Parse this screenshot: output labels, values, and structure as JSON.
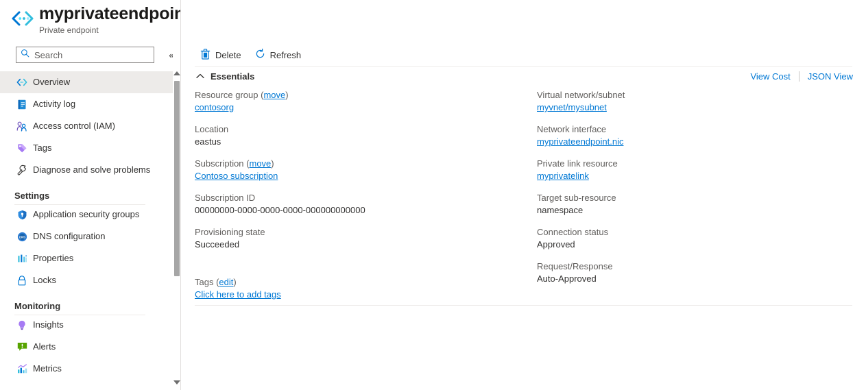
{
  "header": {
    "resource_icon": "private-endpoint-icon",
    "title": "myprivateendpoint",
    "subtitle": "Private endpoint",
    "favorite_icon": "star-icon",
    "more_icon": "ellipsis-icon",
    "more_label": "···",
    "close_icon": "close-icon"
  },
  "sidebar": {
    "search": {
      "placeholder": "Search",
      "value": "",
      "icon": "search-icon"
    },
    "collapse_icon": "chevron-double-left-icon",
    "collapse_label": "«",
    "items": [
      {
        "label": "Overview",
        "icon": "private-endpoint-icon",
        "selected": true
      },
      {
        "label": "Activity log",
        "icon": "activity-log-icon",
        "selected": false
      },
      {
        "label": "Access control (IAM)",
        "icon": "access-control-icon",
        "selected": false
      },
      {
        "label": "Tags",
        "icon": "tag-icon",
        "selected": false
      },
      {
        "label": "Diagnose and solve problems",
        "icon": "wrench-icon",
        "selected": false
      }
    ],
    "group_settings": "Settings",
    "settings_items": [
      {
        "label": "Application security groups",
        "icon": "shield-icon"
      },
      {
        "label": "DNS configuration",
        "icon": "dns-icon"
      },
      {
        "label": "Properties",
        "icon": "properties-icon"
      },
      {
        "label": "Locks",
        "icon": "lock-icon"
      }
    ],
    "group_monitoring": "Monitoring",
    "monitoring_items": [
      {
        "label": "Insights",
        "icon": "lightbulb-icon"
      },
      {
        "label": "Alerts",
        "icon": "alert-icon"
      },
      {
        "label": "Metrics",
        "icon": "metrics-icon"
      }
    ],
    "scrollbar": {
      "up_icon": "scroll-up-arrow",
      "down_icon": "scroll-down-arrow"
    }
  },
  "toolbar": {
    "delete_label": "Delete",
    "delete_icon": "trash-icon",
    "refresh_label": "Refresh",
    "refresh_icon": "refresh-icon"
  },
  "essentials": {
    "chevron_icon": "chevron-up-icon",
    "title": "Essentials",
    "view_cost_label": "View Cost",
    "json_view_label": "JSON View",
    "left_fields": [
      {
        "label": "Resource group",
        "label_link": "move",
        "value": "contosorg",
        "value_is_link": true
      },
      {
        "label": "Location",
        "value": "eastus",
        "value_is_link": false
      },
      {
        "label": "Subscription",
        "label_link": "move",
        "value": "Contoso subscription",
        "value_is_link": true
      },
      {
        "label": "Subscription ID",
        "value": "00000000-0000-0000-0000-000000000000",
        "value_is_link": false
      },
      {
        "label": "Provisioning state",
        "value": "Succeeded",
        "value_is_link": false
      }
    ],
    "right_fields": [
      {
        "label": "Virtual network/subnet",
        "value": "myvnet/mysubnet",
        "value_is_link": true
      },
      {
        "label": "Network interface",
        "value": "myprivateendpoint.nic",
        "value_is_link": true
      },
      {
        "label": "Private link resource",
        "value": "myprivatelink",
        "value_is_link": true
      },
      {
        "label": "Target sub-resource",
        "value": "namespace",
        "value_is_link": false
      },
      {
        "label": "Connection status",
        "value": "Approved",
        "value_is_link": false
      },
      {
        "label": "Request/Response",
        "value": "Auto-Approved",
        "value_is_link": false
      }
    ],
    "tags": {
      "label": "Tags",
      "edit_label": "edit",
      "add_label": "Click here to add tags"
    }
  },
  "colors": {
    "accent": "#0078d4",
    "selected_bg": "#edebe9",
    "label_gray": "#605e5c",
    "border": "#e1dfdd"
  }
}
